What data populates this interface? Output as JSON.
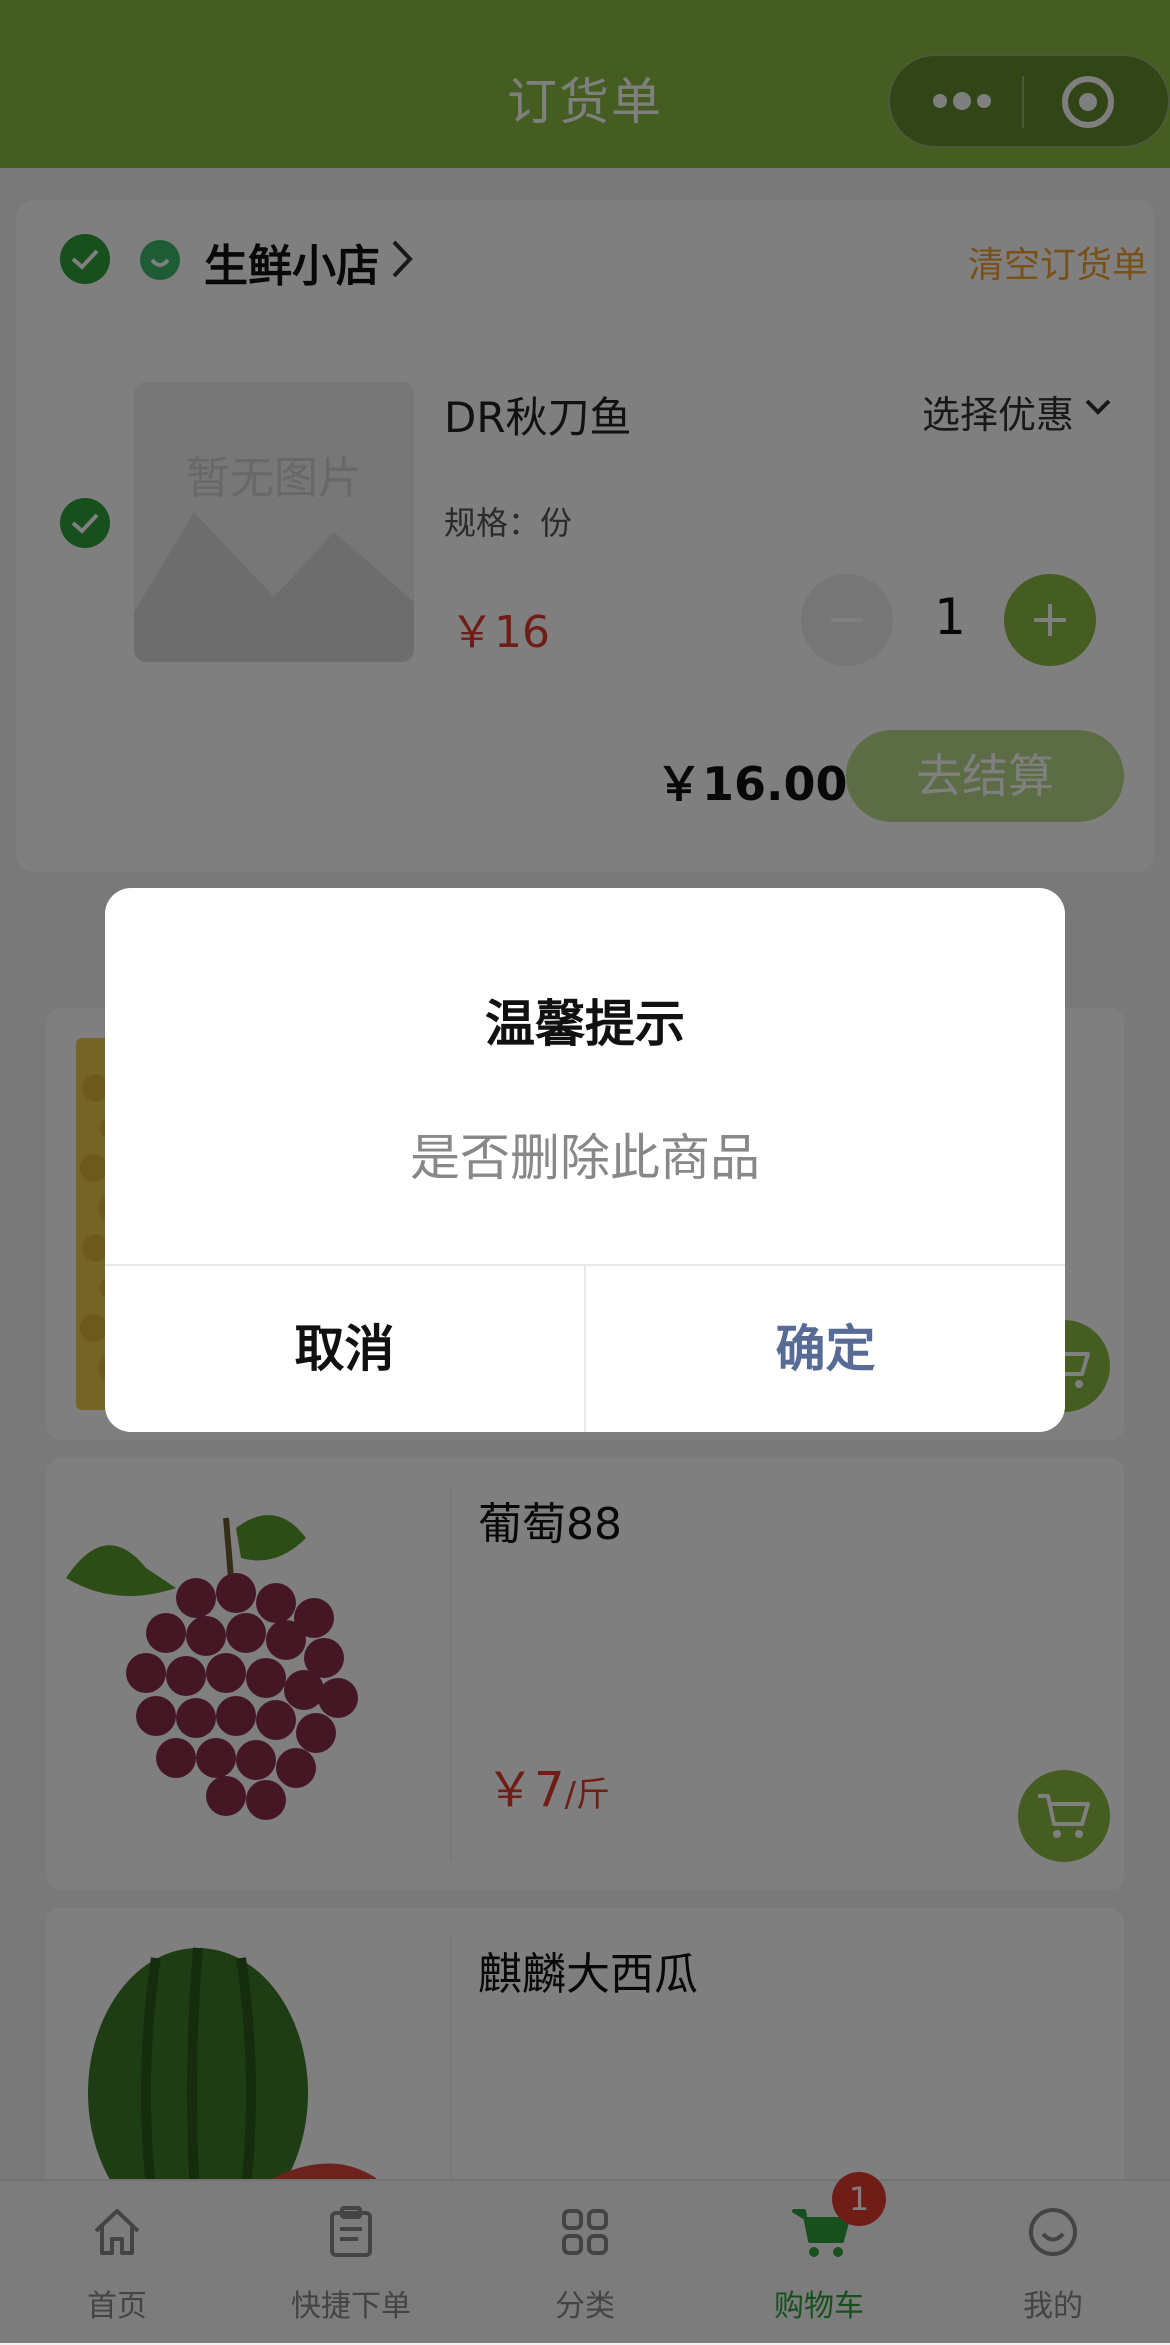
{
  "header": {
    "title": "订货单"
  },
  "store": {
    "name": "生鲜小店",
    "clear_label": "清空订货单",
    "item": {
      "name": "DR秋刀鱼",
      "promo_label": "选择优惠",
      "spec": "规格：份",
      "price": "￥16",
      "placeholder_text": "暂无图片",
      "quantity": "1"
    },
    "total": "￥16.00",
    "checkout_label": "去结算"
  },
  "products": [
    {
      "name": "葡萄88",
      "price": "￥7",
      "unit": "/斤"
    },
    {
      "name": "麒麟大西瓜"
    }
  ],
  "tabbar": {
    "items": [
      {
        "label": "首页",
        "icon": "home-icon"
      },
      {
        "label": "快捷下单",
        "icon": "clipboard-icon"
      },
      {
        "label": "分类",
        "icon": "grid-icon"
      },
      {
        "label": "购物车",
        "icon": "cart-icon"
      },
      {
        "label": "我的",
        "icon": "smile-icon"
      }
    ],
    "cart_badge": "1",
    "active_index": 3
  },
  "dialog": {
    "title": "温馨提示",
    "message": "是否删除此商品",
    "cancel_label": "取消",
    "confirm_label": "确定"
  },
  "colors": {
    "brand_green": "#8bbb42",
    "check_green": "#2e9e3a",
    "price_red": "#e03a2f",
    "clear_orange": "#f0a030",
    "confirm_blue": "#576b95"
  }
}
